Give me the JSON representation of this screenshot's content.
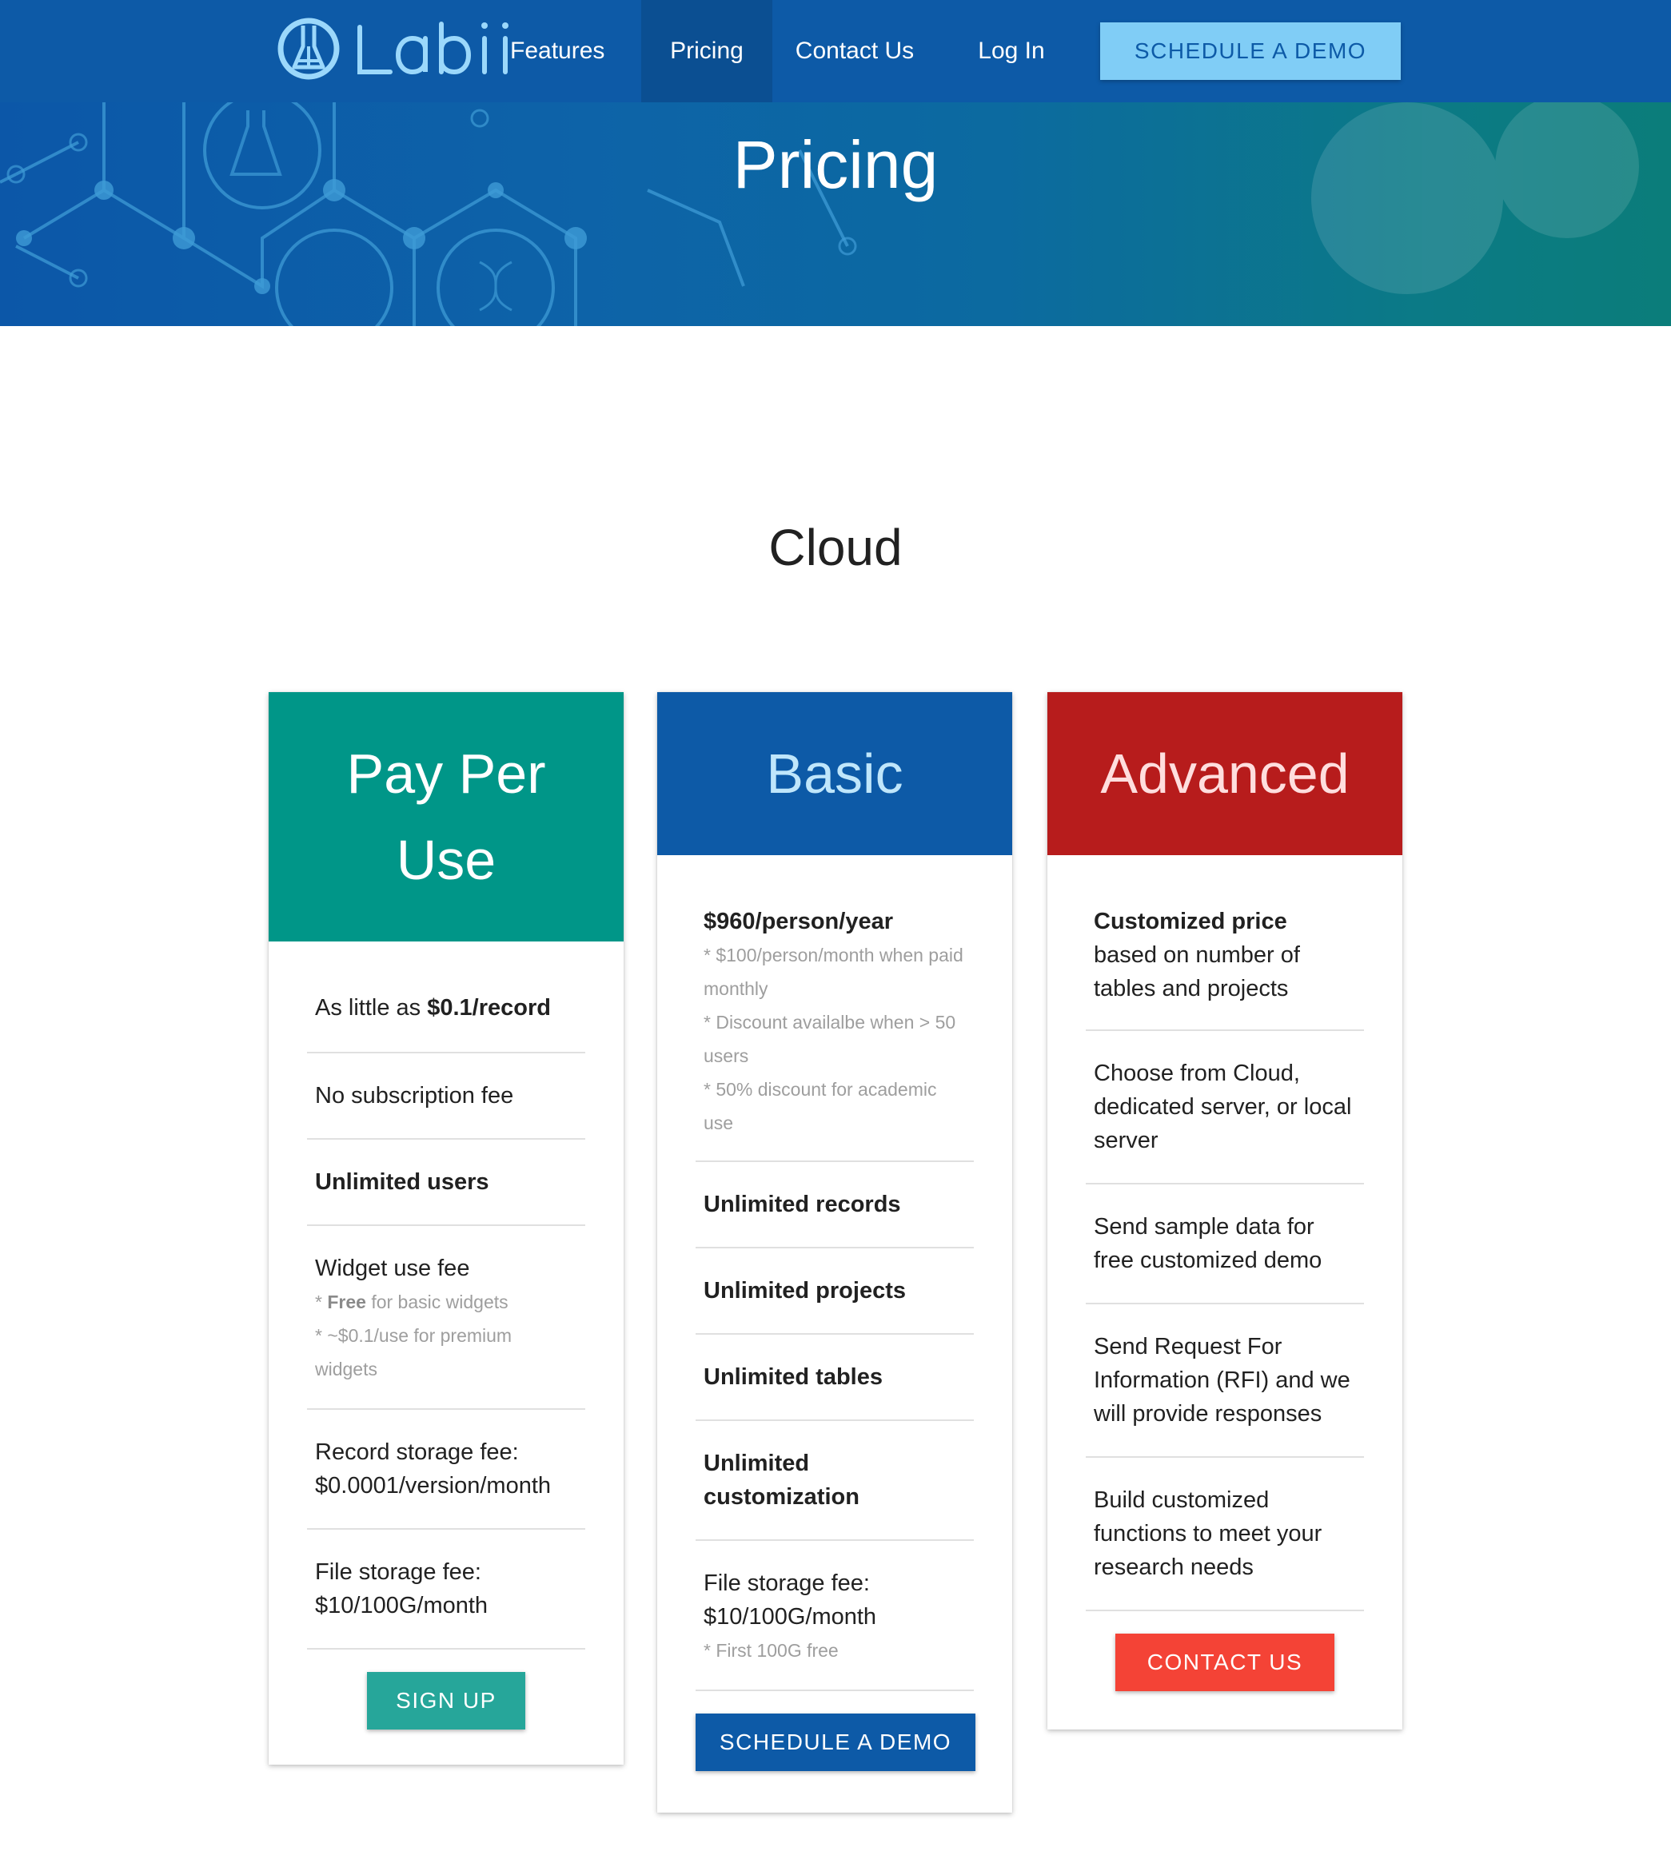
{
  "nav": {
    "logo_text": "LaBii",
    "items": [
      {
        "label": "Features"
      },
      {
        "label": "Pricing"
      },
      {
        "label": "Contact Us"
      },
      {
        "label": "Log In"
      }
    ],
    "cta_label": "SCHEDULE A DEMO"
  },
  "hero": {
    "title": "Pricing"
  },
  "section": {
    "title": "Cloud"
  },
  "colors": {
    "nav_bg": "#0d5aa7",
    "pay_per_use": "#009688",
    "basic": "#0d5aa7",
    "advanced": "#b71c1c",
    "signup_button": "#26a69a",
    "contact_button": "#f44336"
  },
  "plans": [
    {
      "title_line1": "Pay Per",
      "title_line2": "Use",
      "price_prefix": "As little as ",
      "price_bold": "$0.1/record",
      "no_subscription": "No subscription fee",
      "unlimited_users": "Unlimited users",
      "widget_fee": "Widget use fee",
      "widget_note1_prefix": "* ",
      "widget_note1_bold": "Free",
      "widget_note1_rest": " for basic widgets",
      "widget_note2": "* ~$0.1/use for premium widgets",
      "record_fee_line1": "Record storage fee:",
      "record_fee_line2": "$0.0001/version/month",
      "file_fee_line1": "File storage fee:",
      "file_fee_line2": "$10/100G/month",
      "button": "SIGN UP"
    },
    {
      "title": "Basic",
      "price": "$960/person/year",
      "note1": "* $100/person/month when paid monthly",
      "note2": "* Discount availalbe when > 50 users",
      "note3": "* 50% discount for academic use",
      "feature1": "Unlimited records",
      "feature2": "Unlimited projects",
      "feature3": "Unlimited tables",
      "feature4": "Unlimited customization",
      "file_fee_line1": "File storage fee:",
      "file_fee_line2": "$10/100G/month",
      "file_note": "* First 100G free",
      "button": "SCHEDULE A DEMO"
    },
    {
      "title": "Advanced",
      "price_bold": "Customized price",
      "price_rest": "based on number of tables and projects",
      "feature1": "Choose from Cloud, dedicated server, or local server",
      "feature2": "Send sample data for free customized demo",
      "feature3": "Send Request For Information (RFI) and we will provide responses",
      "feature4": "Build customized functions to meet your research needs",
      "button": "CONTACT US"
    }
  ]
}
